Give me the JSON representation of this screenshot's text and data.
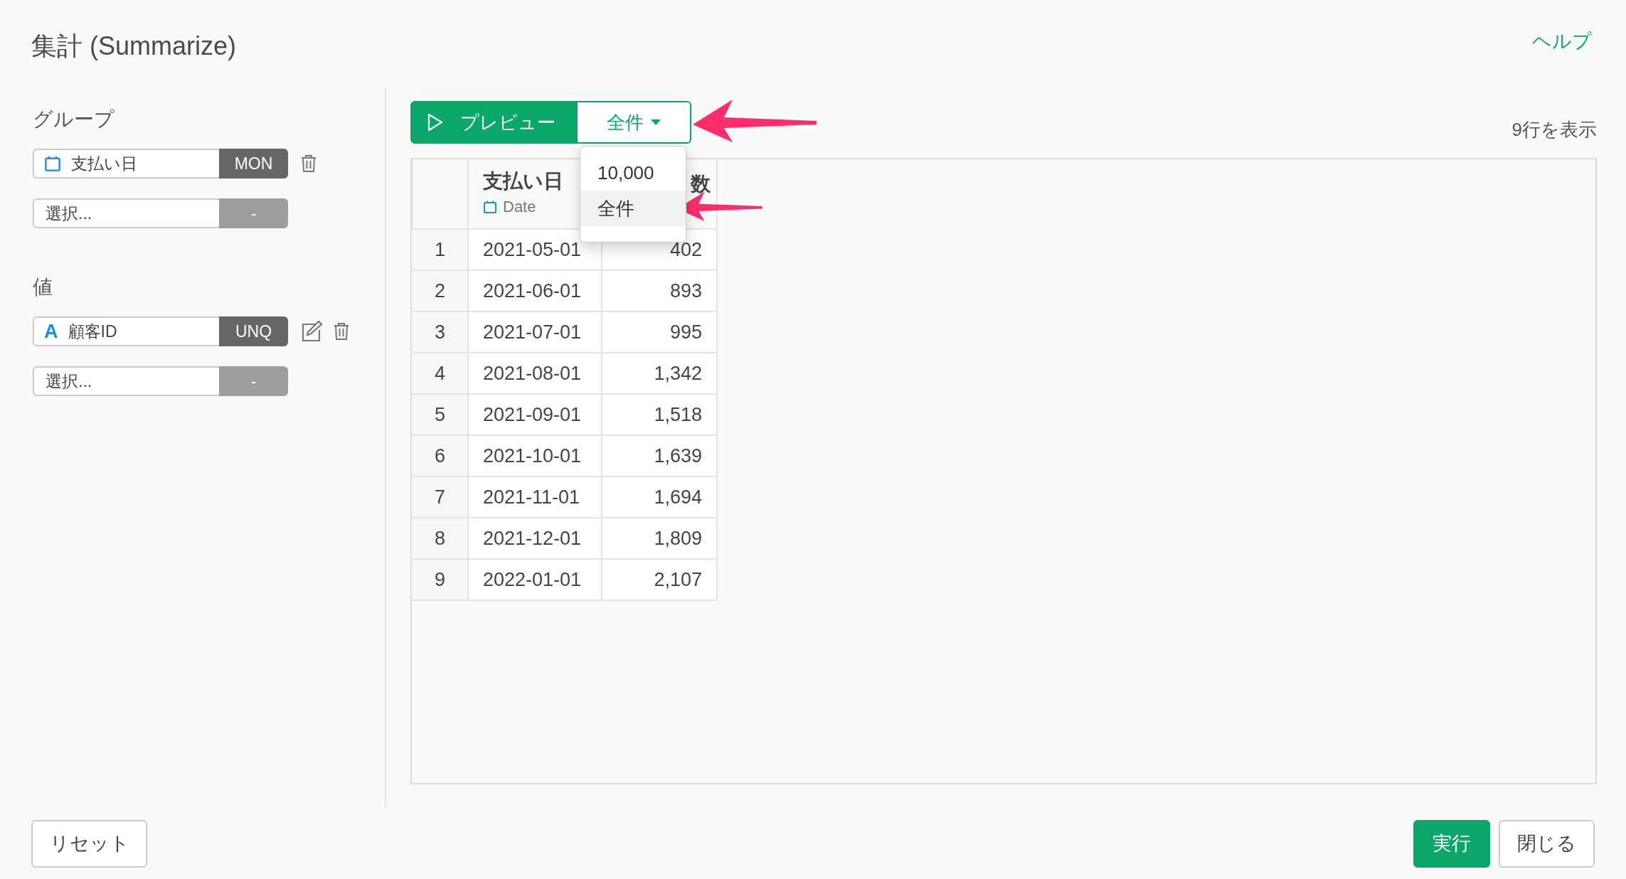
{
  "title": "集計 (Summarize)",
  "help_link": "ヘルプ",
  "groups": {
    "label": "グループ",
    "fields": [
      {
        "kind": "date",
        "name": "支払い日",
        "function": "MON",
        "editable": false
      },
      {
        "kind": "empty",
        "name": "選択...",
        "function": "-",
        "editable": false
      }
    ]
  },
  "values": {
    "label": "値",
    "fields": [
      {
        "kind": "text",
        "type_glyph": "A",
        "name": "顧客ID",
        "function": "UNQ",
        "editable": true
      },
      {
        "kind": "empty",
        "name": "選択...",
        "function": "-",
        "editable": false
      }
    ]
  },
  "preview_button": "プレビュー",
  "row_limit": "全件",
  "row_limit_menu": [
    {
      "label": "10,000",
      "selected": false
    },
    {
      "label": "全件",
      "selected": true
    }
  ],
  "row_count": "9行を表示",
  "table": {
    "columns": [
      {
        "kind": "index"
      },
      {
        "name": "支払い日",
        "type": "Date",
        "kind": "date"
      },
      {
        "name": "数",
        "kind": "number"
      }
    ],
    "rows": [
      [
        "1",
        "2021-05-01",
        "402"
      ],
      [
        "2",
        "2021-06-01",
        "893"
      ],
      [
        "3",
        "2021-07-01",
        "995"
      ],
      [
        "4",
        "2021-08-01",
        "1,342"
      ],
      [
        "5",
        "2021-09-01",
        "1,518"
      ],
      [
        "6",
        "2021-10-01",
        "1,639"
      ],
      [
        "7",
        "2021-11-01",
        "1,694"
      ],
      [
        "8",
        "2021-12-01",
        "1,809"
      ],
      [
        "9",
        "2022-01-01",
        "2,107"
      ]
    ]
  },
  "callout_arrows": [
    {
      "color": "#ff2d6a"
    },
    {
      "color": "#ff2d6a"
    }
  ],
  "buttons": {
    "reset": "リセット",
    "run": "実行",
    "close": "閉じる"
  }
}
